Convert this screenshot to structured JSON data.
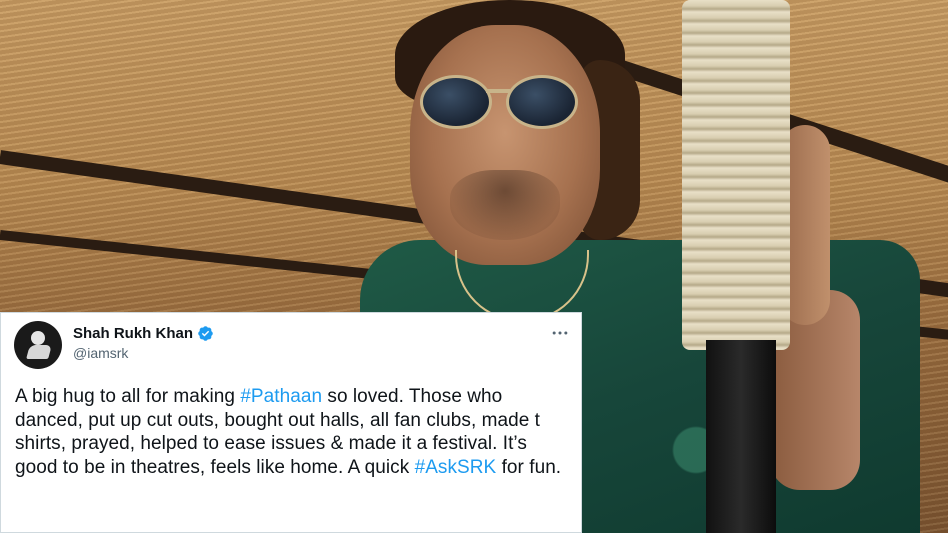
{
  "tweet": {
    "user_name": "Shah Rukh Khan",
    "handle": "@iamsrk",
    "text": {
      "part1": "A big hug to all for making ",
      "hashtag1": "#Pathaan",
      "part2": " so loved. Those who danced, put up cut outs, bought out halls, all fan clubs, made t shirts, prayed, helped to ease issues & made it a festival. It’s good to be in theatres, feels like home. A quick ",
      "hashtag2": "#AskSRK",
      "part3": " for fun."
    },
    "icons": {
      "verified": "verified-badge-icon",
      "more": "more-options-icon"
    },
    "colors": {
      "hashtag": "#1d9bf0",
      "verified": "#1d9bf0",
      "text": "#0f1419",
      "handle": "#536471"
    }
  }
}
